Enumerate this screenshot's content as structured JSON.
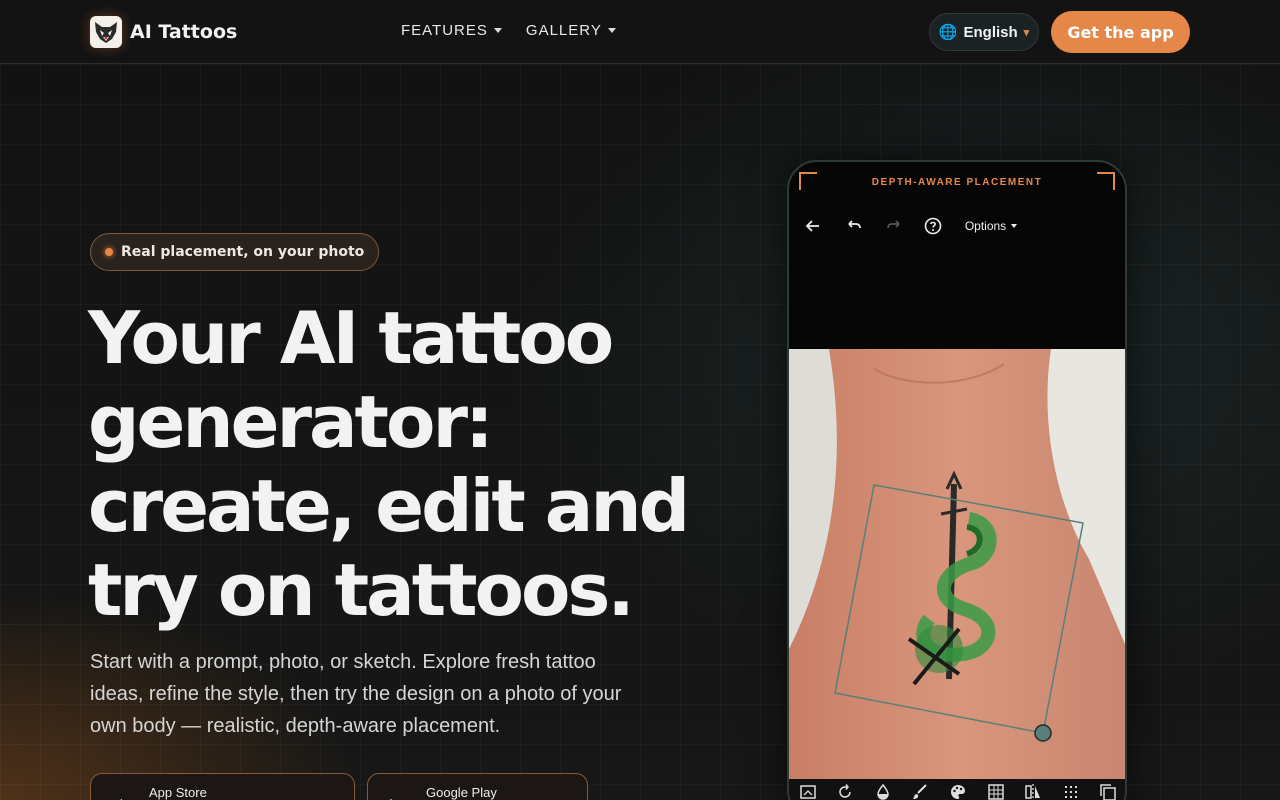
{
  "brand": {
    "name": "AI Tattoos"
  },
  "nav": {
    "items": [
      {
        "label": "FEATURES"
      },
      {
        "label": "GALLERY"
      }
    ]
  },
  "header": {
    "language": "English",
    "cta_label": "Get the app"
  },
  "hero": {
    "badge": "Real placement, on your photo",
    "headline_lines": [
      "Your AI tattoo",
      "generator:",
      "create, edit and",
      "try on tattoos."
    ],
    "subtitle": "Start with a prompt, photo, or sketch. Explore fresh tattoo ideas, refine the style, then try the design on a photo of your own body — realistic, depth-aware placement.",
    "stores": [
      {
        "label": "App Store"
      },
      {
        "label": "Google Play"
      }
    ]
  },
  "phone": {
    "label": "DEPTH-AWARE PLACEMENT",
    "toolbar": {
      "options_label": "Options"
    },
    "bottom_tools": [
      "crop-icon",
      "rotate-icon",
      "opacity-icon",
      "brush-icon",
      "palette-icon",
      "grid-icon",
      "flip-icon",
      "pattern-icon",
      "duplicate-icon"
    ]
  },
  "colors": {
    "accent": "#e6874a",
    "background": "#141414"
  }
}
